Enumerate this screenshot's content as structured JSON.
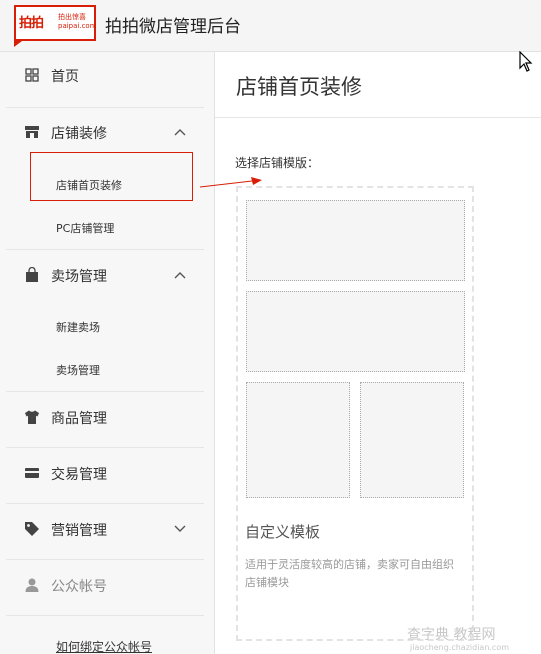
{
  "header": {
    "logo_text": "拍拍",
    "logo_sub_line1": "拍出惊喜",
    "logo_sub_line2": "paipai.com",
    "app_title": "拍拍微店管理后台"
  },
  "sidebar": {
    "home": "首页",
    "store_decoration": {
      "label": "店铺装修",
      "children": [
        "店铺首页装修",
        "PC店铺管理"
      ]
    },
    "venue_management": {
      "label": "卖场管理",
      "children": [
        "新建卖场",
        "卖场管理"
      ]
    },
    "goods": "商品管理",
    "trade": "交易管理",
    "marketing": "营销管理",
    "public_account": "公众帐号",
    "bind_link": "如何绑定公众帐号"
  },
  "main": {
    "page_title": "店铺首页装修",
    "choose_label": "选择店铺模版：",
    "template": {
      "title": "自定义模板",
      "description": "适用于灵活度较高的店铺，卖家可自由组织店铺模块"
    }
  },
  "watermark": {
    "main": "查字典 教程网",
    "sub": "jiaocheng.chazidian.com"
  },
  "colors": {
    "accent": "#d81e06",
    "sidebar_bg": "#f7f7f7",
    "header_bg": "#f5f5f5"
  }
}
